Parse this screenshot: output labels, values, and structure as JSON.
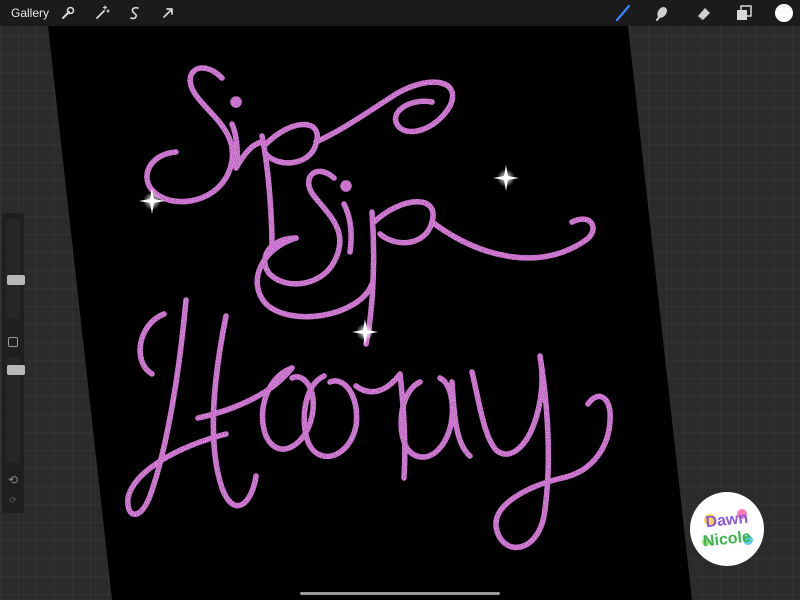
{
  "app": {
    "gallery_label": "Gallery"
  },
  "toolbar": {
    "left_tools": [
      "wrench-icon",
      "magic-wand-icon",
      "selection-icon",
      "transform-arrow-icon"
    ],
    "right_tools": [
      "brush-icon",
      "smudge-icon",
      "eraser-icon",
      "layers-icon"
    ],
    "brush_color": "#3a86ff",
    "current_color": "#ffffff"
  },
  "artwork": {
    "lettering": [
      "Sip",
      "Sip",
      "Hooray"
    ],
    "glitter_color": "#c25ac8"
  },
  "logo": {
    "line1": "Dawn",
    "line2": "Nicole",
    "line1_color": "#8e5bd8",
    "line2_color": "#3bb54a"
  }
}
